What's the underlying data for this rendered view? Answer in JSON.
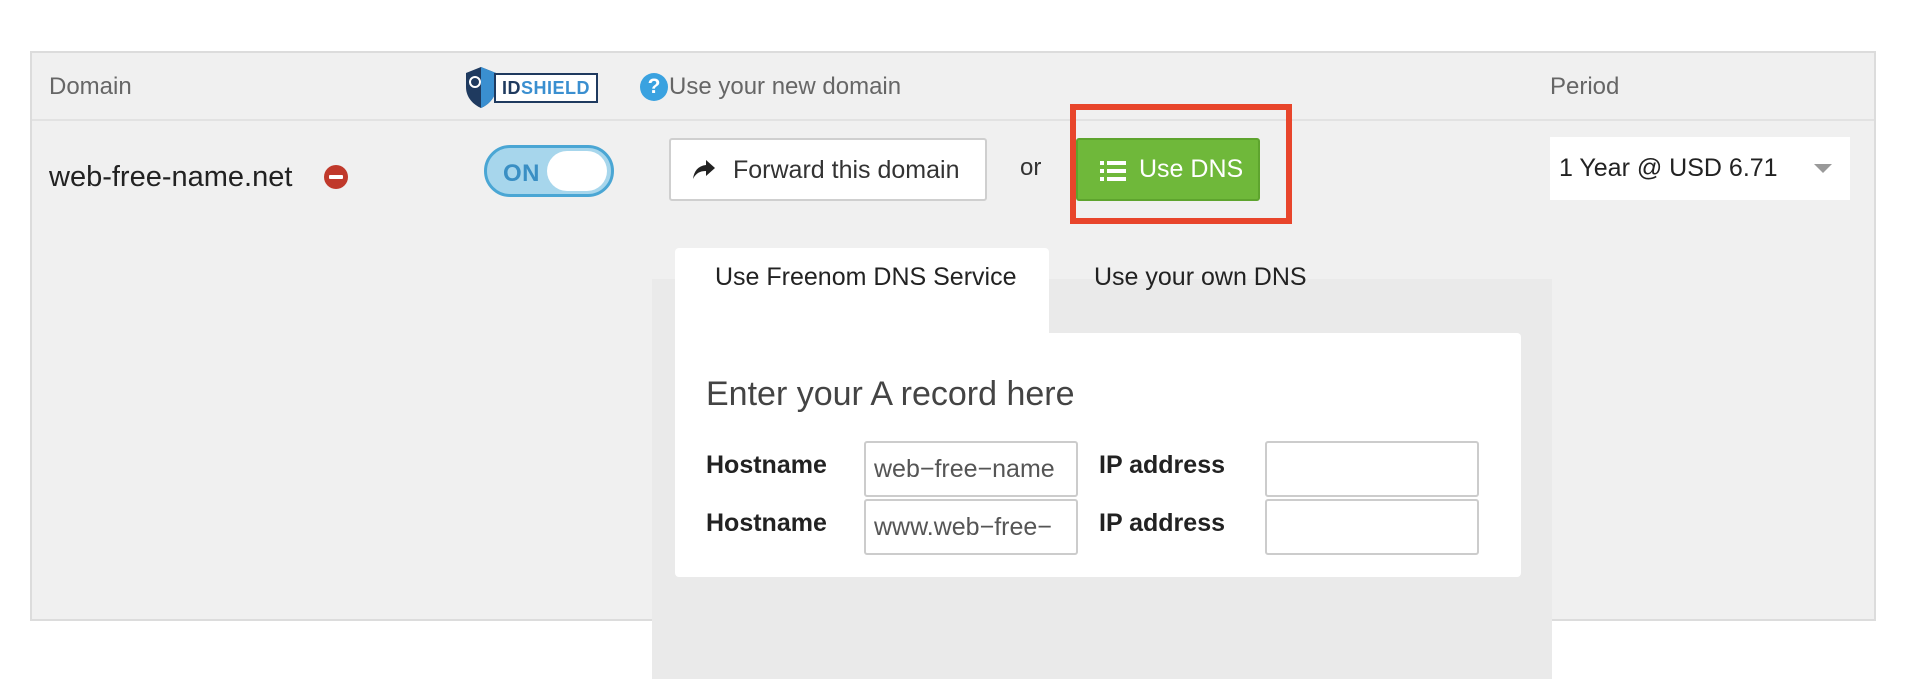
{
  "header": {
    "domain_col": "Domain",
    "use_domain_col": "Use your new domain",
    "period_col": "Period",
    "idshield_id": "ID",
    "idshield_shield": "SHIELD"
  },
  "row": {
    "domain_name": "web-free-name.net",
    "idshield_toggle": "ON",
    "forward_button": "Forward this domain",
    "or_text": "or",
    "use_dns_button": "Use DNS",
    "period_selected": "1 Year @ USD 6.71"
  },
  "dns": {
    "tabs": [
      {
        "label": "Use Freenom DNS Service",
        "active": true
      },
      {
        "label": "Use your own DNS",
        "active": false
      }
    ],
    "title": "Enter your A record here",
    "records": [
      {
        "hostname_label": "Hostname",
        "hostname_value": "web−free−name",
        "ip_label": "IP address",
        "ip_value": ""
      },
      {
        "hostname_label": "Hostname",
        "hostname_value": "www.web−free−",
        "ip_label": "IP address",
        "ip_value": ""
      }
    ]
  },
  "colors": {
    "use_dns_green": "#6fb83a",
    "highlight_red": "#e8452b",
    "toggle_blue": "#a7d6ec",
    "remove_red": "#c0392b",
    "help_blue": "#3aa2e0"
  },
  "icons": {
    "remove": "minus-circle-icon",
    "help": "question-circle-icon",
    "forward": "share-arrow-icon",
    "dns": "list-icon",
    "select": "caret-down-icon"
  }
}
